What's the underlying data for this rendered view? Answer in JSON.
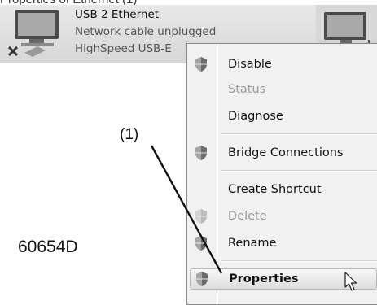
{
  "caption_fragment": "Properties of Ethernet (1)",
  "adapter": {
    "name": "USB 2 Ethernet",
    "status": "Network cable unplugged",
    "device": "HighSpeed USB-E",
    "icon": "network-adapter-disconnected-icon"
  },
  "adapter2": {
    "icon": "network-adapter-icon"
  },
  "context_menu": {
    "items": [
      {
        "label": "Disable",
        "icon": "shield-icon",
        "disabled": false
      },
      {
        "label": "Status",
        "icon": null,
        "disabled": true
      },
      {
        "label": "Diagnose",
        "icon": null,
        "disabled": false
      },
      {
        "label": "Bridge Connections",
        "icon": "shield-icon",
        "disabled": false
      },
      {
        "label": "Create Shortcut",
        "icon": null,
        "disabled": false
      },
      {
        "label": "Delete",
        "icon": "shield-icon",
        "disabled": true
      },
      {
        "label": "Rename",
        "icon": "shield-icon",
        "disabled": false
      },
      {
        "label": "Properties",
        "icon": "shield-icon",
        "disabled": false,
        "highlighted": true
      }
    ]
  },
  "callout": {
    "label": "(1)"
  },
  "figure_code": "60654D",
  "cursor": {
    "icon": "mouse-pointer-icon"
  }
}
